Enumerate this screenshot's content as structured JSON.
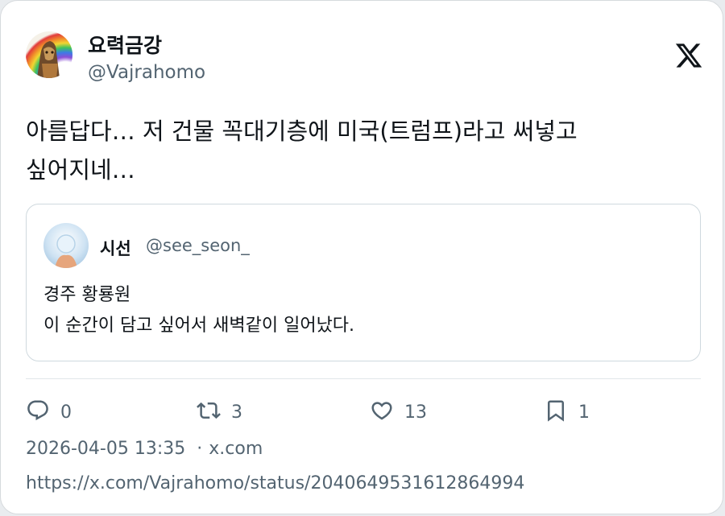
{
  "author": {
    "name": "요력금강",
    "handle": "@Vajrahomo"
  },
  "brand": {
    "icon": "x-logo-icon"
  },
  "tweet": {
    "text": "아름답다… 저 건물 꼭대기층에 미국(트럼프)라고 써넣고\n싶어지네…"
  },
  "quoted": {
    "name": "시선",
    "handle": "@see_seon_",
    "text": "경주 황룡원\n이 순간이 담고 싶어서 새벽같이 일어났다."
  },
  "actions": {
    "reply": {
      "icon": "reply-icon",
      "count": "0"
    },
    "retweet": {
      "icon": "retweet-icon",
      "count": "3"
    },
    "like": {
      "icon": "heart-icon",
      "count": "13"
    },
    "bookmark": {
      "icon": "bookmark-icon",
      "count": "1"
    }
  },
  "meta": {
    "timestamp": "2026-04-05 13:35",
    "separator": "·",
    "source": "x.com"
  },
  "url": "https://x.com/Vajrahomo/status/2040649531612864994",
  "colors": {
    "text": "#0f1419",
    "secondary": "#536471",
    "border": "#cfd9de",
    "background": "#ffffff"
  }
}
